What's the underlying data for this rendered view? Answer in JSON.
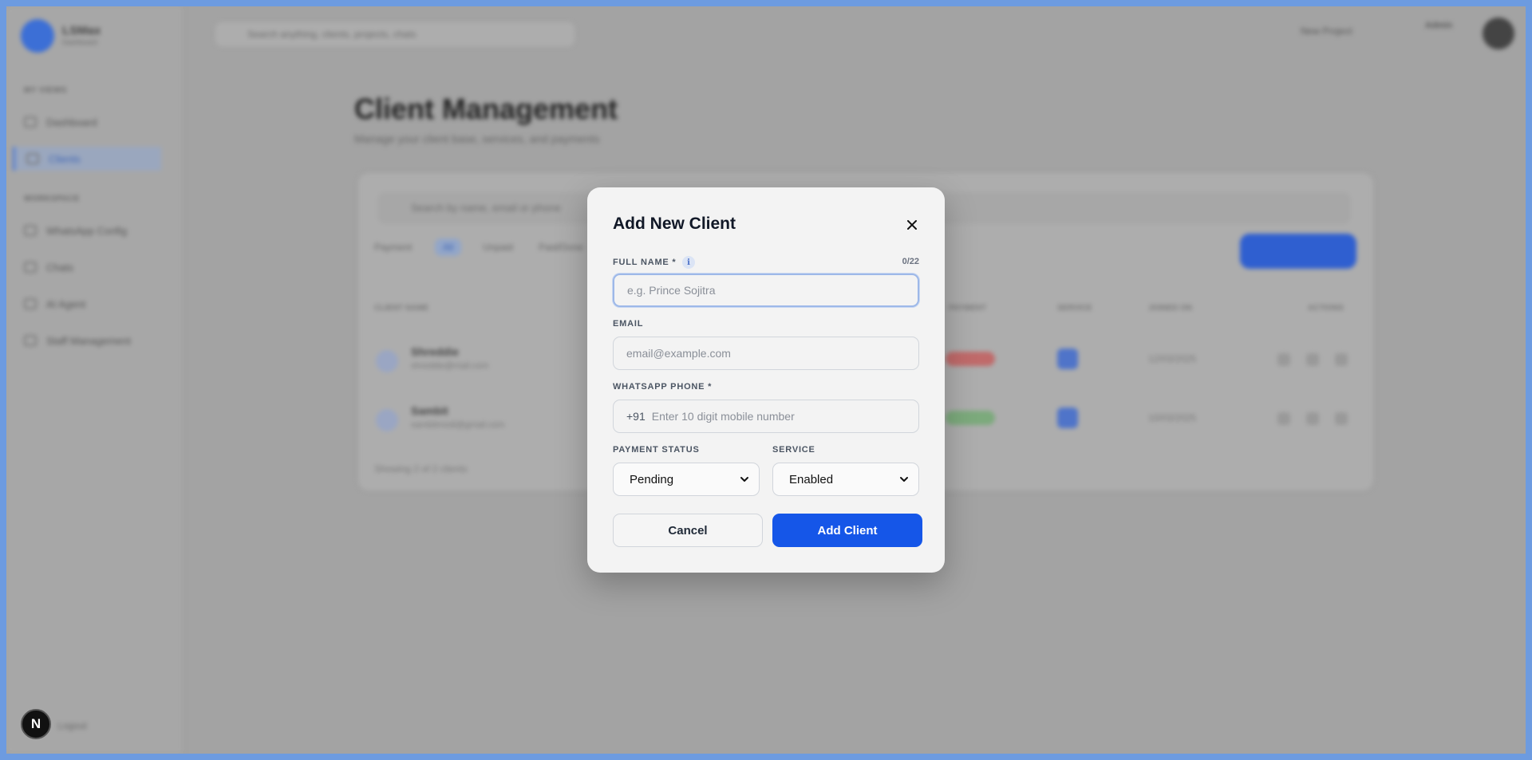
{
  "app": {
    "logo_text": "LSMax",
    "logo_sub": "Dashboard",
    "search_placeholder": "Search anything, clients, projects, chats",
    "top_button": "New Project",
    "user_name": "Admin",
    "nav_sections": [
      "MY VIEWS",
      "WORKSPACE"
    ],
    "nav_items": [
      "Dashboard",
      "Clients",
      "WhatsApp Config",
      "Chats",
      "AI Agent",
      "Staff Management"
    ],
    "bottom_badge": "N",
    "bottom_text": "Logout"
  },
  "page": {
    "title": "Client Management",
    "subtitle": "Manage your client base, services, and payments",
    "search_placeholder": "Search by name, email or phone",
    "filters": [
      "Payment",
      "All",
      "Unpaid",
      "Paid/Done"
    ],
    "columns": [
      "CLIENT NAME",
      "PAYMENT",
      "SERVICE",
      "JOINED ON",
      "ACTIONS"
    ],
    "rows": [
      {
        "name": "Shreddie",
        "email": "shreddie@mail.com",
        "date": "12/03/2025"
      },
      {
        "name": "Sambit",
        "email": "sambitmodi@gmail.com",
        "date": "10/03/2025"
      }
    ],
    "footer": "Showing 2 of 2 clients"
  },
  "modal": {
    "title": "Add New Client",
    "full_name_label": "FULL NAME *",
    "full_name_placeholder": "e.g. Prince Sojitra",
    "full_name_value": "",
    "char_count": "0/22",
    "email_label": "EMAIL",
    "email_placeholder": "email@example.com",
    "phone_label": "WHATSAPP PHONE *",
    "phone_prefix": "+91",
    "phone_placeholder": "Enter 10 digit mobile number",
    "payment_label": "PAYMENT STATUS",
    "payment_value": "Pending",
    "service_label": "SERVICE",
    "service_value": "Enabled",
    "cancel_label": "Cancel",
    "submit_label": "Add Client"
  },
  "colors": {
    "accent": "#1556e8",
    "overlay": "#a3a3a3",
    "frame": "#6d9be0"
  },
  "icons": {
    "close": "close-icon",
    "info": "info-icon",
    "chevron": "chevron-down-icon"
  }
}
